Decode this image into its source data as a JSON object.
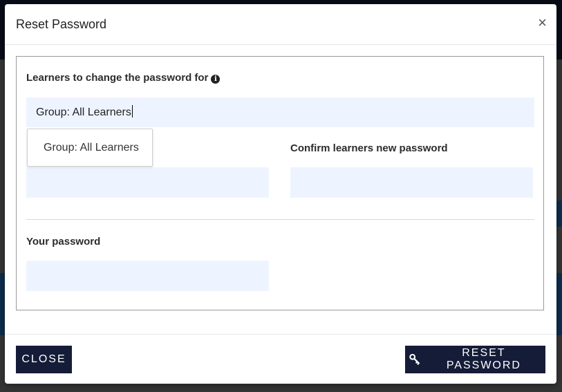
{
  "modal": {
    "title": "Reset Password",
    "close_icon": "×",
    "fields": {
      "learners_label": "Learners to change the password for",
      "learners_value": "Group: All Learners",
      "confirm_label": "Confirm learners new password",
      "your_password_label": "Your password"
    },
    "dropdown": {
      "options": [
        "Group: All Learners"
      ]
    },
    "footer": {
      "close_label": "CLOSE",
      "reset_label": "RESET PASSWORD"
    }
  },
  "icons": [
    "close-icon",
    "info-icon",
    "key-icon"
  ],
  "colors": {
    "button_bg": "#141c38",
    "field_bg": "#eef4ff",
    "topbar": "#10192f",
    "bg_accent_blue": "#1c5a98"
  }
}
